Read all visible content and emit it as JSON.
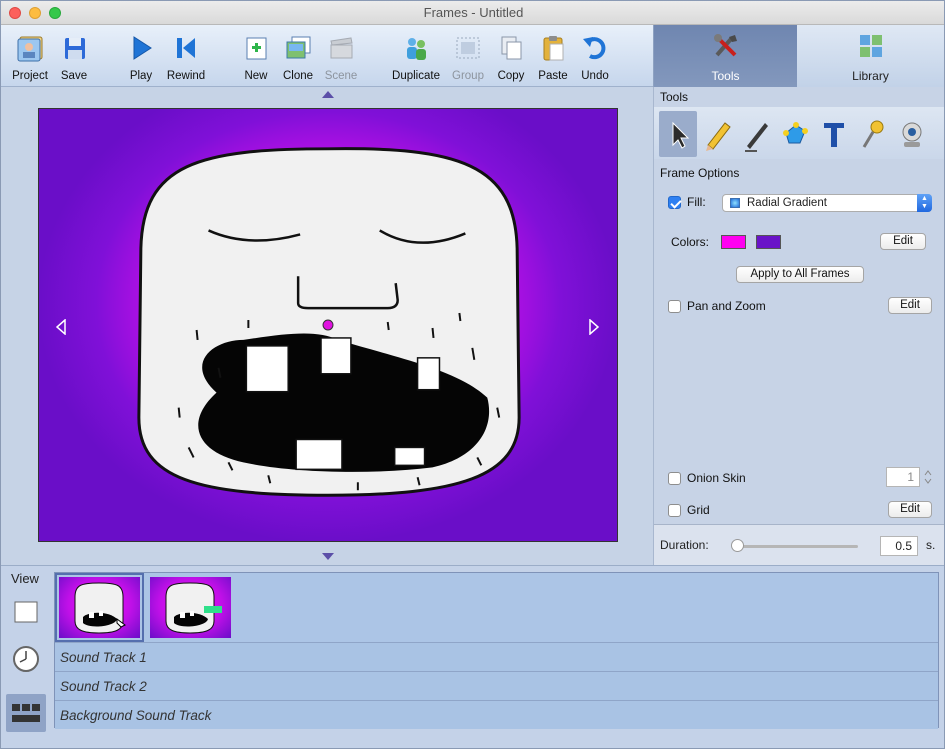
{
  "window": {
    "title": "Frames - Untitled"
  },
  "toolbar": {
    "project": "Project",
    "save": "Save",
    "play": "Play",
    "rewind": "Rewind",
    "new": "New",
    "clone": "Clone",
    "scene": "Scene",
    "duplicate": "Duplicate",
    "group": "Group",
    "copy": "Copy",
    "paste": "Paste",
    "undo": "Undo"
  },
  "tabs": {
    "tools": "Tools",
    "library": "Library"
  },
  "panel": {
    "tools_title": "Tools",
    "frame_options_title": "Frame Options",
    "fill_label": "Fill:",
    "fill_value": "Radial Gradient",
    "colors_label": "Colors:",
    "color1": "#ff00f0",
    "color2": "#6a14c8",
    "edit_label": "Edit",
    "apply_all": "Apply to All Frames",
    "pan_zoom": "Pan and Zoom",
    "onion_skin": "Onion Skin",
    "onion_value": "1",
    "grid": "Grid",
    "duration_label": "Duration:",
    "duration_value": "0.5",
    "duration_unit": "s."
  },
  "bottom": {
    "view_label": "View",
    "tracks": [
      "Sound Track 1",
      "Sound Track 2",
      "Background Sound Track"
    ]
  },
  "colors": {
    "accent": "#2e80f2",
    "canvas_outer": "#6a0ec8",
    "canvas_inner": "#ff10ff"
  }
}
